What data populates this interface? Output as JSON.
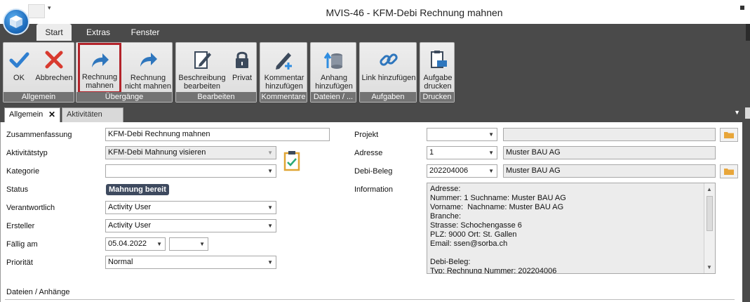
{
  "window": {
    "title": "MVIS-46 - KFM-Debi Rechnung mahnen",
    "qat_dropdown": "▾"
  },
  "ribbon_tabs": [
    "Start",
    "Extras",
    "Fenster"
  ],
  "ribbon": {
    "groups": {
      "allgemein": "Allgemein",
      "uebergaenge": "Übergänge",
      "bearbeiten": "Bearbeiten",
      "kommentare": "Kommentare",
      "dateien": "Dateien / ...",
      "aufgaben": "Aufgaben",
      "drucken": "Drucken"
    },
    "buttons": {
      "ok": "OK",
      "abbrechen": "Abbrechen",
      "rechnung_mahnen_1": "Rechnung",
      "rechnung_mahnen_2": "mahnen",
      "nicht_mahnen_1": "Rechnung",
      "nicht_mahnen_2": "nicht mahnen",
      "beschreibung_1": "Beschreibung",
      "beschreibung_2": "bearbeiten",
      "privat": "Privat",
      "kommentar_1": "Kommentar",
      "kommentar_2": "hinzufügen",
      "anhang_1": "Anhang",
      "anhang_2": "hinzufügen",
      "link": "Link hinzufügen",
      "aufgabe_1": "Aufgabe",
      "aufgabe_2": "drucken"
    }
  },
  "doc_tabs": {
    "allgemein": "Allgemein",
    "aktivitaeten": "Aktivitäten",
    "close": "✕"
  },
  "form": {
    "zusammenfassung": {
      "label": "Zusammenfassung",
      "value": "KFM-Debi Rechnung mahnen"
    },
    "aktivitaetstyp": {
      "label": "Aktivitätstyp",
      "value": "KFM-Debi Mahnung visieren"
    },
    "kategorie": {
      "label": "Kategorie",
      "value": ""
    },
    "status": {
      "label": "Status",
      "value": "Mahnung bereit"
    },
    "verantwortlich": {
      "label": "Verantwortlich",
      "value": "Activity User"
    },
    "ersteller": {
      "label": "Ersteller",
      "value": "Activity User"
    },
    "faellig_am": {
      "label": "Fällig am",
      "date": "05.04.2022",
      "time": ""
    },
    "prioritaet": {
      "label": "Priorität",
      "value": "Normal"
    },
    "projekt": {
      "label": "Projekt",
      "code": "",
      "name": ""
    },
    "adresse": {
      "label": "Adresse",
      "code": "1",
      "name": "Muster BAU AG"
    },
    "debi_beleg": {
      "label": "Debi-Beleg",
      "code": "202204006",
      "name": "Muster BAU AG"
    },
    "information": {
      "label": "Information",
      "lines": [
        "Adresse:",
        "Nummer: 1 Suchname: Muster BAU AG",
        "Vorname:  Nachname: Muster BAU AG",
        "Branche:",
        "Strasse: Schochengasse 6",
        "PLZ: 9000 Ort: St. Gallen",
        "Email: ssen@sorba.ch",
        "",
        "Debi-Beleg:",
        "Typ: Rechnung Nummer: 202204006"
      ]
    },
    "dateien_section": "Dateien / Anhänge"
  },
  "colors": {
    "ribbon_bg": "#4a4a4a",
    "highlight_border": "#b3232a",
    "status_badge": "#3e4a5f",
    "ok_blue": "#2f7fd0",
    "cancel_red": "#d83a2f"
  }
}
